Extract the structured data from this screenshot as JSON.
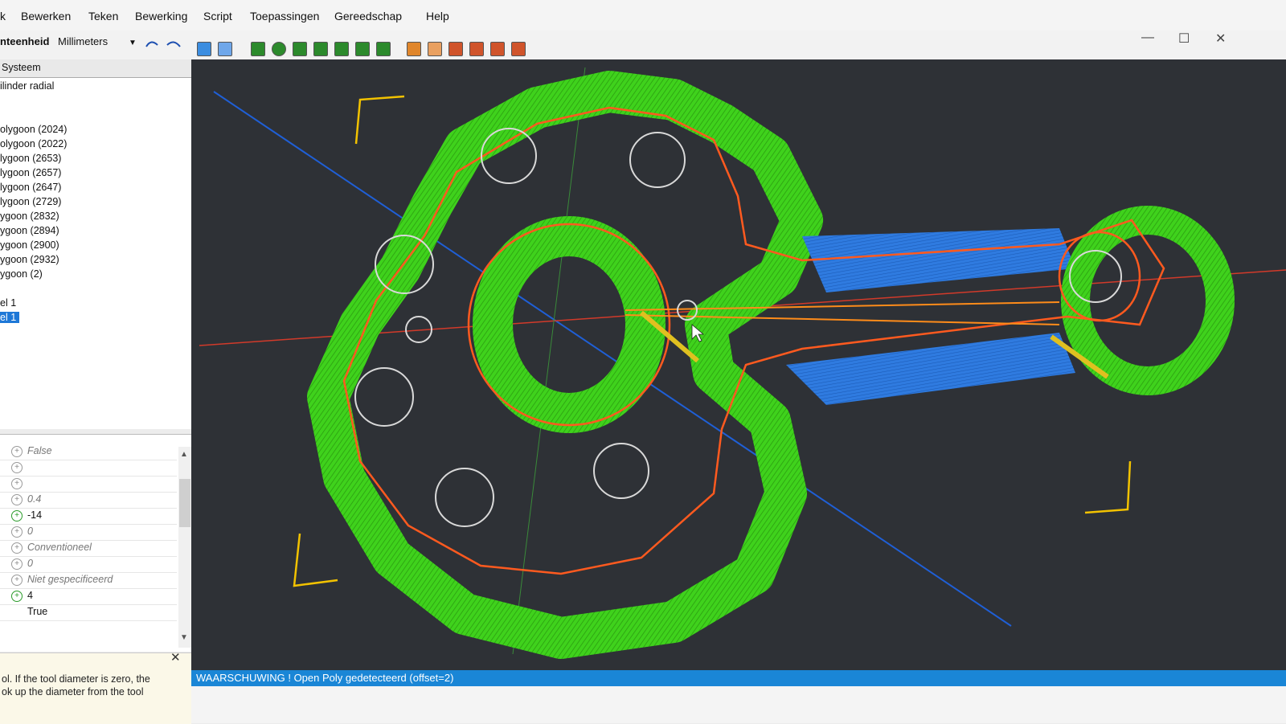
{
  "menu": {
    "items": [
      {
        "label": "k"
      },
      {
        "label": "Bewerken"
      },
      {
        "label": "Teken"
      },
      {
        "label": "Bewerking"
      },
      {
        "label": "Script"
      },
      {
        "label": "Toepassingen"
      },
      {
        "label": "Gereedschap"
      },
      {
        "label": "Help"
      }
    ]
  },
  "window_controls": {
    "minimize": "—",
    "maximize": "☐",
    "close": "✕"
  },
  "toolbar": {
    "unit_label": "nteenheid",
    "unit_value": "Millimeters",
    "undo_icon": "undo-icon",
    "redo_icon": "redo-icon"
  },
  "left_panel": {
    "tab": "Systeem",
    "tree": [
      "ilinder radial",
      "olygoon (2024)",
      "olygoon (2022)",
      "lygoon (2653)",
      "lygoon (2657)",
      "lygoon (2647)",
      "lygoon (2729)",
      "ygoon (2832)",
      "ygoon (2894)",
      "ygoon (2900)",
      "ygoon (2932)",
      "ygoon (2)",
      "el 1",
      "el 1"
    ]
  },
  "properties": {
    "rows": [
      {
        "value": "False",
        "active": false
      },
      {
        "value": "",
        "active": false
      },
      {
        "value": "",
        "active": false
      },
      {
        "value": "0.4",
        "active": false
      },
      {
        "value": "-14",
        "active": true
      },
      {
        "value": "0",
        "active": false
      },
      {
        "value": "Conventioneel",
        "active": false
      },
      {
        "value": "0",
        "active": false
      },
      {
        "value": "Niet gespecificeerd",
        "active": false
      },
      {
        "value": "4",
        "active": true
      },
      {
        "value": "True",
        "active": false
      }
    ]
  },
  "help": {
    "close_label": "✕",
    "line1": "ol.  If the tool diameter is zero, the",
    "line2": "ok up the diameter from the tool"
  },
  "status": {
    "message": "WAARSCHUWING ! Open Poly gedetecteerd (offset=2)"
  },
  "colors": {
    "viewport_bg": "#2e3136",
    "toolpath_green": "#3fd21c",
    "toolpath_blue": "#2f7be0",
    "contour_orange": "#ff5a1f",
    "status_blue": "#1a86d6",
    "bracket_yellow": "#f2c200"
  }
}
